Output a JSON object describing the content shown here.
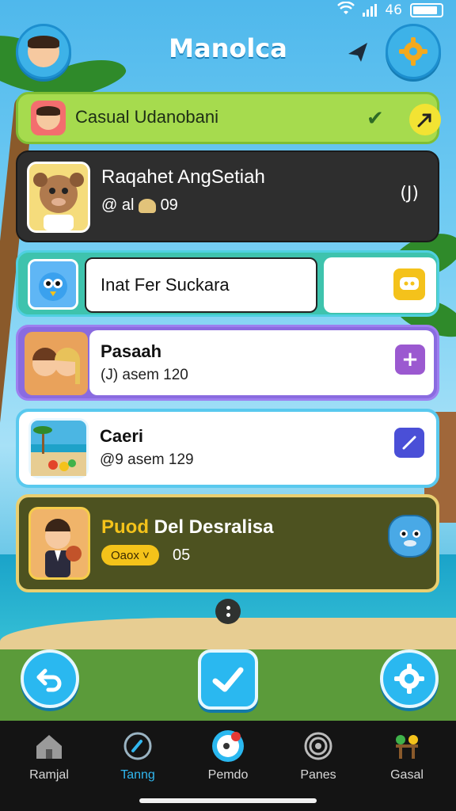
{
  "app": {
    "title": "Manolca"
  },
  "status": {
    "time": "46"
  },
  "quests": {
    "active": {
      "label": "Casual Udanobani"
    },
    "profile": {
      "name": "Raqahet AngSetiah",
      "handle": "@ al",
      "score": "09",
      "badge": "(J)"
    },
    "search": {
      "placeholder": "Inat Fer Suckara"
    },
    "rows": [
      {
        "name": "Pasaah",
        "sub": "(J) asem 120"
      },
      {
        "name": "Caeri",
        "sub": "@9 asem 129"
      }
    ],
    "featured": {
      "name_highlight": "Puod",
      "name_rest": " Del Desralisa",
      "pill": "Oaox ˅",
      "count": "05"
    }
  },
  "nav": {
    "items": [
      {
        "label": "Ramjal",
        "icon": "home-icon"
      },
      {
        "label": "Tanng",
        "icon": "compass-icon"
      },
      {
        "label": "Pemdo",
        "icon": "profile-icon"
      },
      {
        "label": "Panes",
        "icon": "spiral-icon"
      },
      {
        "label": "Gasal",
        "icon": "garden-icon"
      }
    ],
    "active_index": 1
  },
  "colors": {
    "accent": "#2ab8f0",
    "gold": "#f4c31a",
    "purple": "#9b59d0",
    "green": "#a6db4e"
  }
}
